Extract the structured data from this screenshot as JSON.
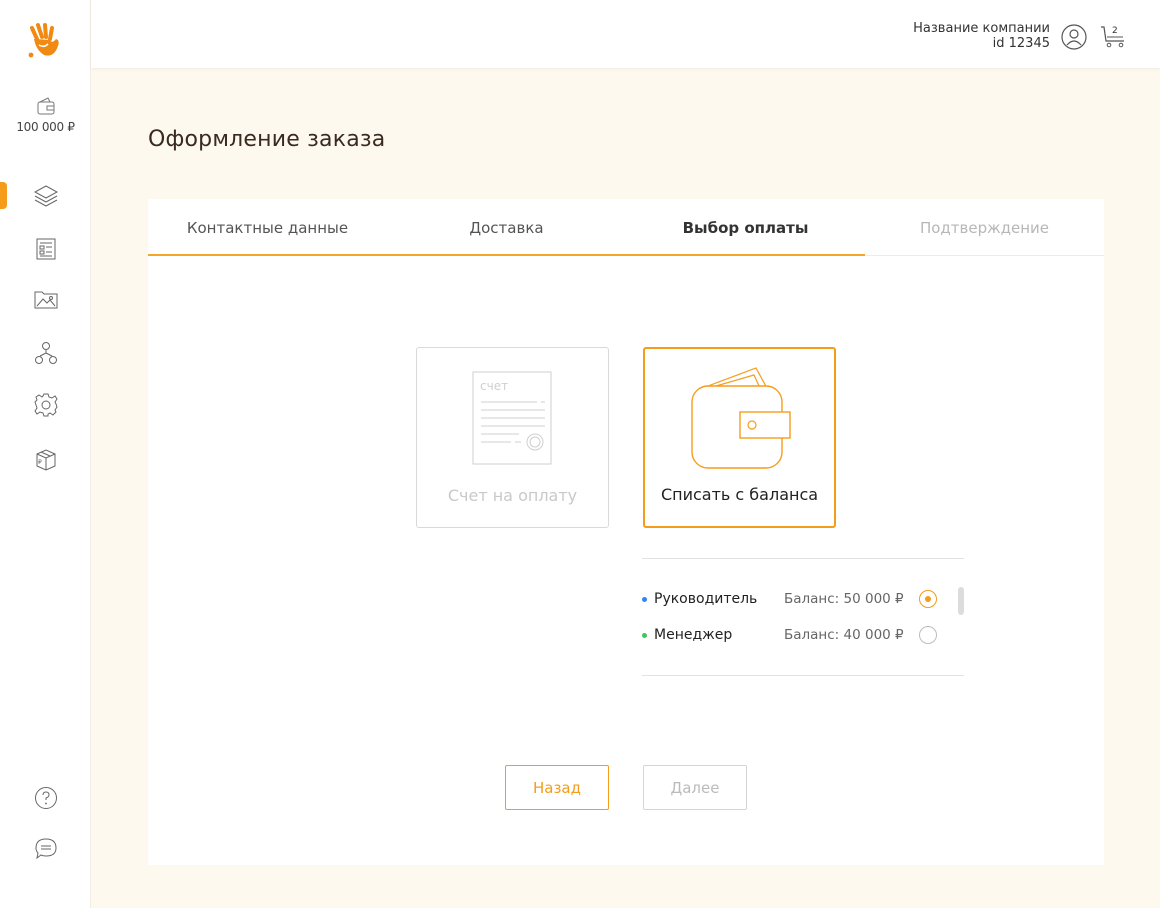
{
  "sidebar": {
    "wallet_amount": "100 000 ₽",
    "accent_color": "#f59c1a",
    "nav_items": [
      {
        "icon": "layers-icon",
        "active": true
      },
      {
        "icon": "catalog-icon",
        "active": false
      },
      {
        "icon": "gallery-icon",
        "active": false
      },
      {
        "icon": "team-icon",
        "active": false
      },
      {
        "icon": "gear-icon",
        "active": false
      },
      {
        "icon": "box-icon",
        "active": false
      }
    ],
    "bottom_items": [
      {
        "icon": "help-icon"
      },
      {
        "icon": "chat-icon"
      }
    ]
  },
  "header": {
    "company_name": "Название компании",
    "company_id": "id 12345",
    "cart_count": "2"
  },
  "page": {
    "title": "Оформление заказа"
  },
  "tabs": [
    {
      "label": "Контактные данные",
      "state": "done"
    },
    {
      "label": "Доставка",
      "state": "done"
    },
    {
      "label": "Выбор оплаты",
      "state": "active"
    },
    {
      "label": "Подтверждение",
      "state": "disabled"
    }
  ],
  "payment": {
    "invoice": {
      "label": "Счет на оплату",
      "doc_text": "счет",
      "selected": false
    },
    "balance": {
      "label": "Списать с баланса",
      "selected": true
    }
  },
  "accounts": [
    {
      "name": "Руководитель",
      "balance": "Баланс: 50 000 ₽",
      "dot_color": "#2f86f0",
      "selected": true
    },
    {
      "name": "Менеджер",
      "balance": "Баланс: 40 000 ₽",
      "dot_color": "#3cc85a",
      "selected": false
    }
  ],
  "buttons": {
    "back": "Назад",
    "next": "Далее"
  }
}
